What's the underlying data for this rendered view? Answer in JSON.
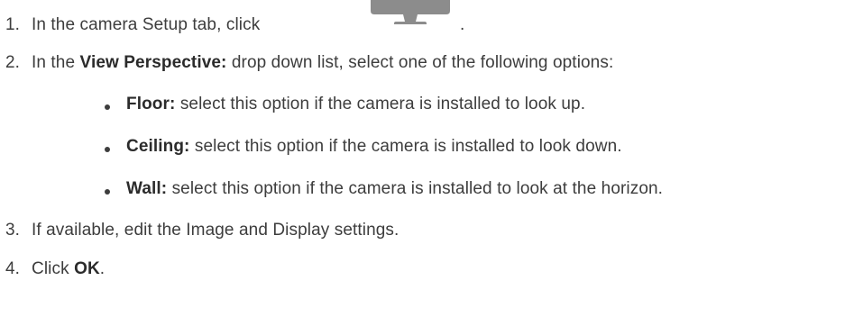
{
  "steps": [
    {
      "number": "1.",
      "text_before_icon": "In the camera Setup tab, click",
      "icon": "monitor-icon",
      "text_after_icon": "."
    },
    {
      "number": "2.",
      "prefix": "In the",
      "bold": "View Perspective:",
      "suffix": "drop down list, select one of the following options:",
      "options": [
        {
          "bold": "Floor:",
          "text": "select this option if the camera is installed to look up."
        },
        {
          "bold": "Ceiling:",
          "text": "select this option if the camera is installed to look down."
        },
        {
          "bold": "Wall:",
          "text": "select this option if the camera is installed to look at the horizon."
        }
      ]
    },
    {
      "number": "3.",
      "text": "If available, edit the Image and Display settings."
    },
    {
      "number": "4.",
      "prefix": "Click",
      "bold": "OK",
      "suffix": "."
    }
  ],
  "colors": {
    "text": "#3d3d3d",
    "icon_gray": "#8c8c8c"
  }
}
